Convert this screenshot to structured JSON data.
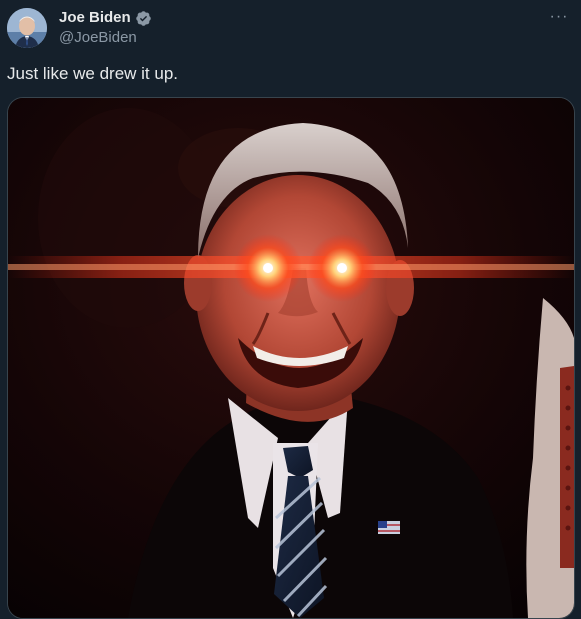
{
  "author": {
    "display_name": "Joe Biden",
    "handle": "@JoeBiden",
    "verified": true,
    "avatar_icon": "profile-photo-avatar",
    "verified_icon": "verified-badge-icon"
  },
  "more_menu": {
    "icon": "more-horizontal-icon",
    "glyph": "···"
  },
  "tweet": {
    "text": "Just like we drew it up."
  },
  "media": {
    "alt_description_icon": "photo-portrait-laser-eyes",
    "laser_color": "#ff3b1f"
  },
  "colors": {
    "background": "#15202b",
    "primary_text": "#e7e9ea",
    "secondary_text": "#8b98a5",
    "border": "#38444d"
  }
}
